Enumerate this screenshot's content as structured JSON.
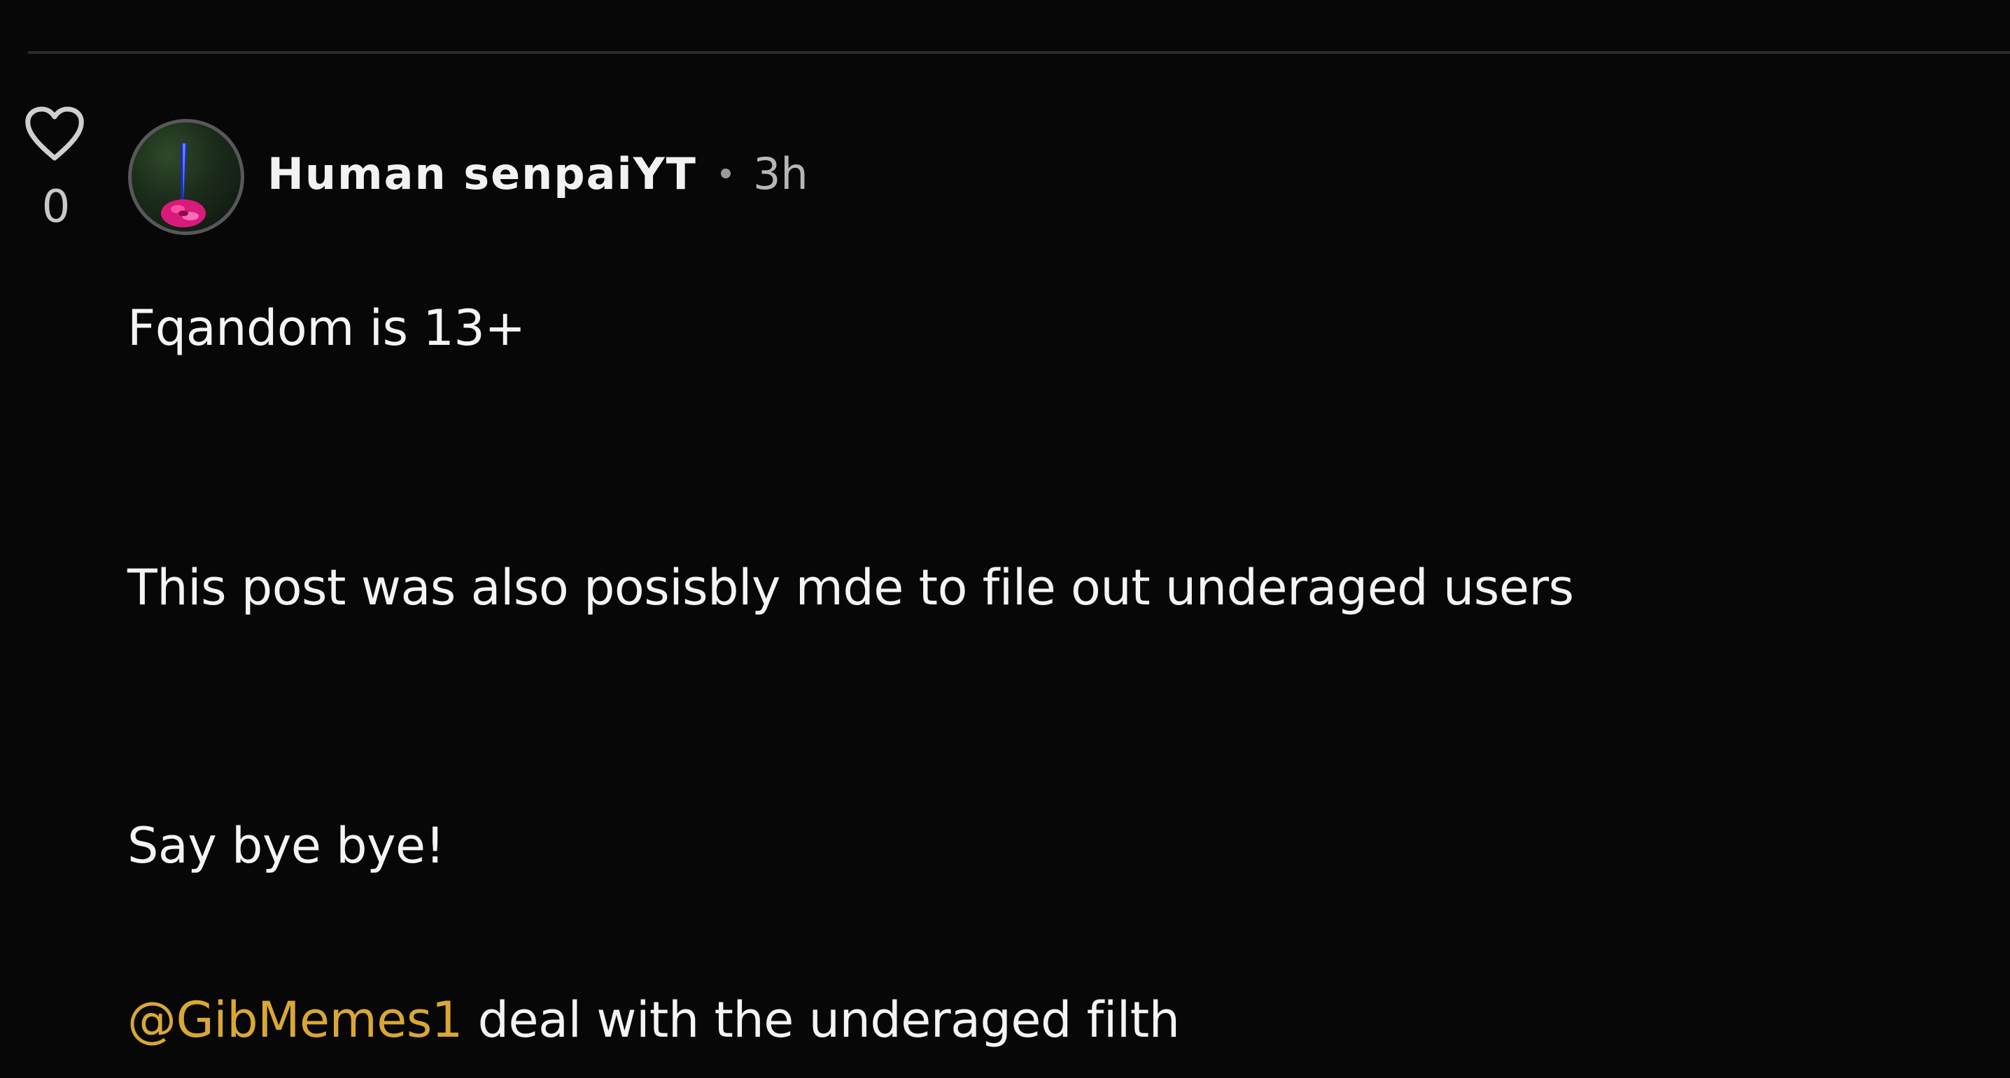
{
  "post": {
    "likes": {
      "count": "0",
      "icon": "heart-outline-icon"
    },
    "author": {
      "name": "Human senpaiYT",
      "time": "3h"
    },
    "content": {
      "line1": "Fqandom is 13+",
      "line2": "This post was also posisbly mde to file out underaged users",
      "line3": "Say bye bye!",
      "mention": "@GibMemes1",
      "line4_rest": " deal with the underaged filth"
    }
  },
  "colors": {
    "background": "#070708",
    "mention": "#d9a735",
    "divider": "#2b2b2e"
  }
}
